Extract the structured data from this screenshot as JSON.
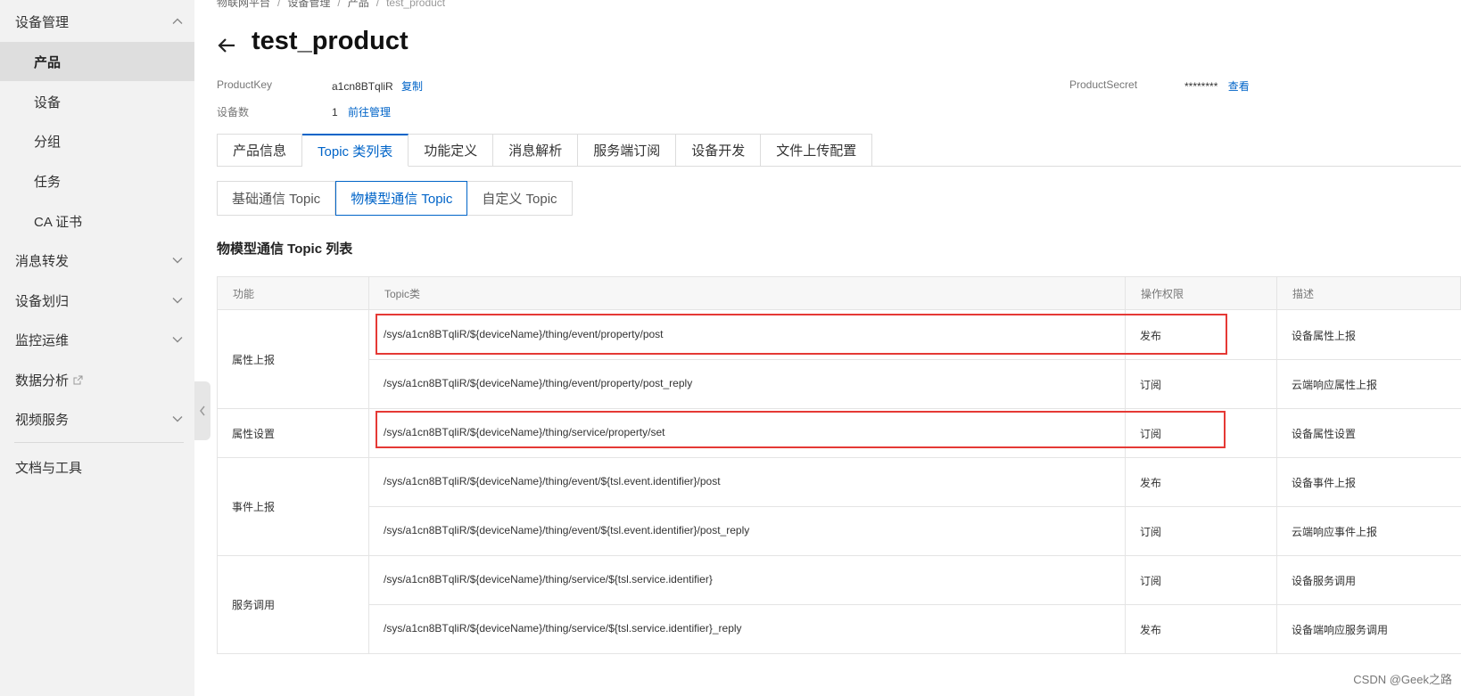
{
  "sidebar": {
    "items": [
      {
        "label": "设备管理",
        "chevron": "up"
      },
      {
        "label": "产品",
        "active": true
      },
      {
        "label": "设备"
      },
      {
        "label": "分组"
      },
      {
        "label": "任务"
      },
      {
        "label": "CA 证书"
      },
      {
        "label": "消息转发",
        "chevron": "down"
      },
      {
        "label": "设备划归",
        "chevron": "down"
      },
      {
        "label": "监控运维",
        "chevron": "down"
      },
      {
        "label": "数据分析",
        "icon": "external-link-icon"
      },
      {
        "label": "视频服务",
        "chevron": "down"
      },
      {
        "label": "文档与工具"
      }
    ]
  },
  "breadcrumb": [
    "物联网平台",
    "设备管理",
    "产品",
    "test_product"
  ],
  "title": "test_product",
  "meta": {
    "product_key_label": "ProductKey",
    "product_key_value": "a1cn8BTqliR",
    "copy_link": "复制",
    "device_count_label": "设备数",
    "device_count_value": "1",
    "manage_link": "前往管理",
    "product_secret_label": "ProductSecret",
    "product_secret_value": "********",
    "view_link": "查看"
  },
  "tabs": [
    "产品信息",
    "Topic 类列表",
    "功能定义",
    "消息解析",
    "服务端订阅",
    "设备开发",
    "文件上传配置"
  ],
  "active_tab": "Topic 类列表",
  "subtabs": [
    "基础通信 Topic",
    "物模型通信 Topic",
    "自定义 Topic"
  ],
  "active_subtab": "物模型通信 Topic",
  "section_title": "物模型通信 Topic 列表",
  "table": {
    "headers": [
      "功能",
      "Topic类",
      "操作权限",
      "描述"
    ],
    "groups": [
      {
        "function": "属性上报",
        "rows": [
          {
            "topic": "/sys/a1cn8BTqliR/${deviceName}/thing/event/property/post",
            "permission": "发布",
            "desc": "设备属性上报",
            "highlight": true
          },
          {
            "topic": "/sys/a1cn8BTqliR/${deviceName}/thing/event/property/post_reply",
            "permission": "订阅",
            "desc": "云端响应属性上报"
          }
        ]
      },
      {
        "function": "属性设置",
        "rows": [
          {
            "topic": "/sys/a1cn8BTqliR/${deviceName}/thing/service/property/set",
            "permission": "订阅",
            "desc": "设备属性设置",
            "highlight": true
          }
        ]
      },
      {
        "function": "事件上报",
        "rows": [
          {
            "topic": "/sys/a1cn8BTqliR/${deviceName}/thing/event/${tsl.event.identifier}/post",
            "permission": "发布",
            "desc": "设备事件上报"
          },
          {
            "topic": "/sys/a1cn8BTqliR/${deviceName}/thing/event/${tsl.event.identifier}/post_reply",
            "permission": "订阅",
            "desc": "云端响应事件上报"
          }
        ]
      },
      {
        "function": "服务调用",
        "rows": [
          {
            "topic": "/sys/a1cn8BTqliR/${deviceName}/thing/service/${tsl.service.identifier}",
            "permission": "订阅",
            "desc": "设备服务调用"
          },
          {
            "topic": "/sys/a1cn8BTqliR/${deviceName}/thing/service/${tsl.service.identifier}_reply",
            "permission": "发布",
            "desc": "设备端响应服务调用"
          }
        ]
      }
    ]
  },
  "colors": {
    "accent": "#0064c8",
    "highlight": "#e53935"
  },
  "watermark": "CSDN @Geek之路"
}
